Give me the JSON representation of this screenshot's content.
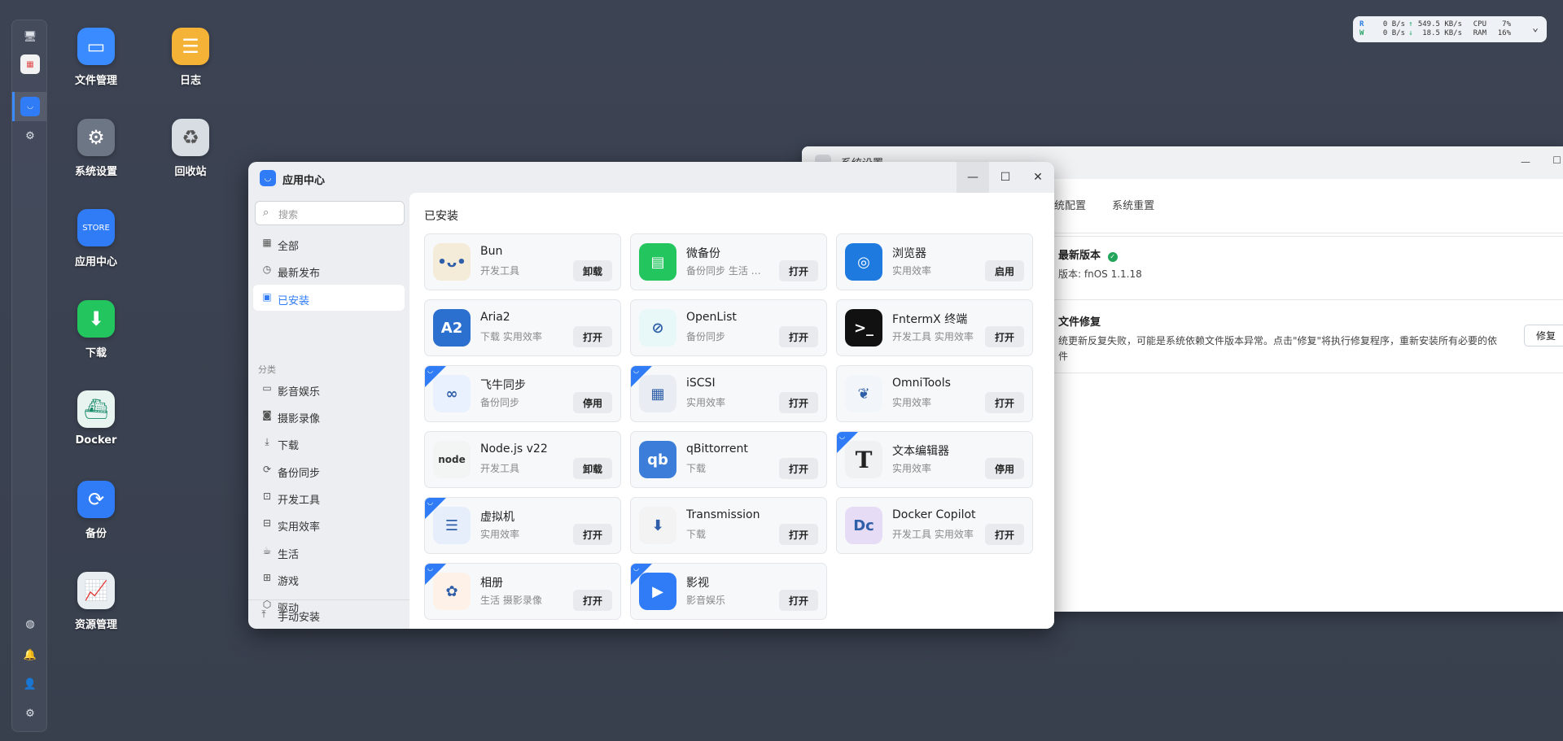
{
  "dock": {
    "icons": [
      "monitor-icon",
      "apps-icon",
      "store-icon",
      "settings-icon",
      "network-icon",
      "bell-icon",
      "user-icon",
      "gear-icon"
    ]
  },
  "desktop": {
    "icons": [
      {
        "label": "文件管理",
        "icon": "folder-icon",
        "color": "#3a8bff"
      },
      {
        "label": "日志",
        "icon": "log-icon",
        "color": "#f4b236"
      },
      {
        "label": "系统设置",
        "icon": "settings-icon",
        "color": "#6d7684"
      },
      {
        "label": "回收站",
        "icon": "recycle-icon",
        "color": "#d8dde3"
      },
      {
        "label": "应用中心",
        "icon": "store-icon",
        "color": "#2f7cf6"
      },
      {
        "label": "下载",
        "icon": "download-icon",
        "color": "#22c55e"
      },
      {
        "label": "Docker",
        "icon": "docker-icon",
        "color": "#e8f4f0"
      },
      {
        "label": "备份",
        "icon": "backup-icon",
        "color": "#2f7cf6"
      },
      {
        "label": "资源管理",
        "icon": "monitor-chart-icon",
        "color": "#e8edf2"
      }
    ]
  },
  "monitor": {
    "r_label": "R",
    "r_speed": "0  B/s",
    "up": "549.5 KB/s",
    "cpu_label": "CPU",
    "cpu": "7%",
    "w_label": "W",
    "w_speed": "0  B/s",
    "down": "18.5 KB/s",
    "ram_label": "RAM",
    "ram": "16%"
  },
  "back_window": {
    "title": "系统设置",
    "tabs": [
      "统配置",
      "系统重置"
    ],
    "update_title": "最新版本",
    "update_text": "版本: fnOS 1.1.18",
    "repair_title": "文件修复",
    "repair_text": "统更新反复失败，可能是系统依赖文件版本异常。点击\"修复\"将执行修复程序，重新安装所有必要的依",
    "repair_text2": "件",
    "repair_button": "修复"
  },
  "window": {
    "title": "应用中心",
    "search_placeholder": "搜索",
    "nav": [
      {
        "label": "全部",
        "icon": "grid-icon"
      },
      {
        "label": "最新发布",
        "icon": "clock-icon"
      },
      {
        "label": "已安装",
        "icon": "installed-icon"
      }
    ],
    "category_title": "分类",
    "categories": [
      {
        "label": "影音娱乐",
        "icon": "video-icon"
      },
      {
        "label": "摄影录像",
        "icon": "camera-icon"
      },
      {
        "label": "下载",
        "icon": "download-icon"
      },
      {
        "label": "备份同步",
        "icon": "sync-icon"
      },
      {
        "label": "开发工具",
        "icon": "code-icon"
      },
      {
        "label": "实用效率",
        "icon": "briefcase-icon"
      },
      {
        "label": "生活",
        "icon": "cup-icon"
      },
      {
        "label": "游戏",
        "icon": "gamepad-icon"
      },
      {
        "label": "驱动",
        "icon": "cube-icon"
      }
    ],
    "manual_install": "手动安装",
    "section_title": "已安装",
    "apps": [
      {
        "name": "Bun",
        "tags": "开发工具",
        "button": "卸载",
        "icon": "bun-icon",
        "color": "#f5ebd9",
        "glyph": "•ᴗ•",
        "ribbon": false
      },
      {
        "name": "微备份",
        "tags": "备份同步 生活 实用效率",
        "button": "打开",
        "icon": "chat-backup-icon",
        "color": "#22c55e",
        "glyph": "▤",
        "ribbon": false
      },
      {
        "name": "浏览器",
        "tags": "实用效率",
        "button": "启用",
        "icon": "browser-icon",
        "color": "#1f7ae0",
        "glyph": "◎",
        "ribbon": false
      },
      {
        "name": "Aria2",
        "tags": "下载 实用效率",
        "button": "打开",
        "icon": "aria2-icon",
        "color": "#2b6fcf",
        "glyph": "A2",
        "ribbon": false
      },
      {
        "name": "OpenList",
        "tags": "备份同步",
        "button": "打开",
        "icon": "openlist-icon",
        "color": "#e8f7f8",
        "glyph": "⊘",
        "ribbon": false
      },
      {
        "name": "FntermX 终端",
        "tags": "开发工具 实用效率",
        "button": "打开",
        "icon": "terminal-icon",
        "color": "#111111",
        "glyph": ">_",
        "ribbon": false
      },
      {
        "name": "飞牛同步",
        "tags": "备份同步",
        "button": "停用",
        "icon": "sync-app-icon",
        "color": "#e9f1fe",
        "glyph": "∞",
        "ribbon": true
      },
      {
        "name": "iSCSI",
        "tags": "实用效率",
        "button": "打开",
        "icon": "iscsi-icon",
        "color": "#e9edf3",
        "glyph": "▦",
        "ribbon": true
      },
      {
        "name": "OmniTools",
        "tags": "实用效率",
        "button": "打开",
        "icon": "omnitools-icon",
        "color": "#f2f6fb",
        "glyph": "❦",
        "ribbon": false
      },
      {
        "name": "Node.js v22",
        "tags": "开发工具",
        "button": "卸载",
        "icon": "nodejs-icon",
        "color": "#f3f4f4",
        "glyph": "node",
        "ribbon": false
      },
      {
        "name": "qBittorrent",
        "tags": "下载",
        "button": "打开",
        "icon": "qbittorrent-icon",
        "color": "#3b7dd8",
        "glyph": "qb",
        "ribbon": false
      },
      {
        "name": "文本编辑器",
        "tags": "实用效率",
        "button": "停用",
        "icon": "text-editor-icon",
        "color": "#f0f1f3",
        "glyph": "T",
        "ribbon": true
      },
      {
        "name": "虚拟机",
        "tags": "实用效率",
        "button": "打开",
        "icon": "vm-icon",
        "color": "#e6eefc",
        "glyph": "☰",
        "ribbon": true
      },
      {
        "name": "Transmission",
        "tags": "下载",
        "button": "打开",
        "icon": "transmission-icon",
        "color": "#f3f3f3",
        "glyph": "⬇",
        "ribbon": false
      },
      {
        "name": "Docker Copilot",
        "tags": "开发工具 实用效率",
        "button": "打开",
        "icon": "docker-copilot-icon",
        "color": "#e6dcf5",
        "glyph": "Dc",
        "ribbon": false
      },
      {
        "name": "相册",
        "tags": "生活 摄影录像",
        "button": "打开",
        "icon": "photos-icon",
        "color": "#fdf1e8",
        "glyph": "✿",
        "ribbon": true
      },
      {
        "name": "影视",
        "tags": "影音娱乐",
        "button": "打开",
        "icon": "video-app-icon",
        "color": "#2f7cf6",
        "glyph": "▶",
        "ribbon": true
      }
    ]
  }
}
